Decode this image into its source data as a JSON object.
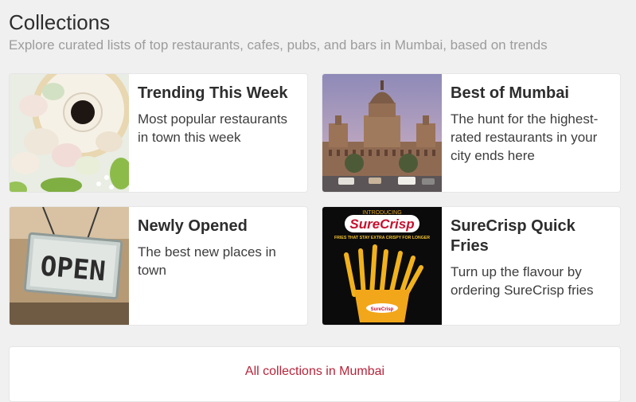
{
  "header": {
    "title": "Collections",
    "subtitle": "Explore curated lists of top restaurants, cafes, pubs, and bars in Mumbai, based on trends"
  },
  "collections": [
    {
      "title": "Trending This Week",
      "description": "Most popular restaurants in town this week",
      "image": "macarons-coffee-image"
    },
    {
      "title": "Best of Mumbai",
      "description": "The hunt for the highest-rated restaurants in your city ends here",
      "image": "mumbai-landmark-image"
    },
    {
      "title": "Newly Opened",
      "description": "The best new places in town",
      "image": "open-sign-image",
      "image_text": "OPEN"
    },
    {
      "title": "SureCrisp Quick Fries",
      "description": "Turn up the flavour by ordering SureCrisp fries",
      "image": "surecrisp-fries-image",
      "image_text": {
        "top": "INTRODUCING",
        "brand": "SureCrisp",
        "tagline": "FRIES THAT STAY EXTRA CRISPY FOR LONGER",
        "box_label": "SureCrisp"
      }
    }
  ],
  "footer": {
    "all_collections_label": "All collections in Mumbai"
  },
  "colors": {
    "accent": "#b8243a",
    "background": "#f0f0f0",
    "card": "#ffffff",
    "muted_text": "#9c9c9c"
  }
}
